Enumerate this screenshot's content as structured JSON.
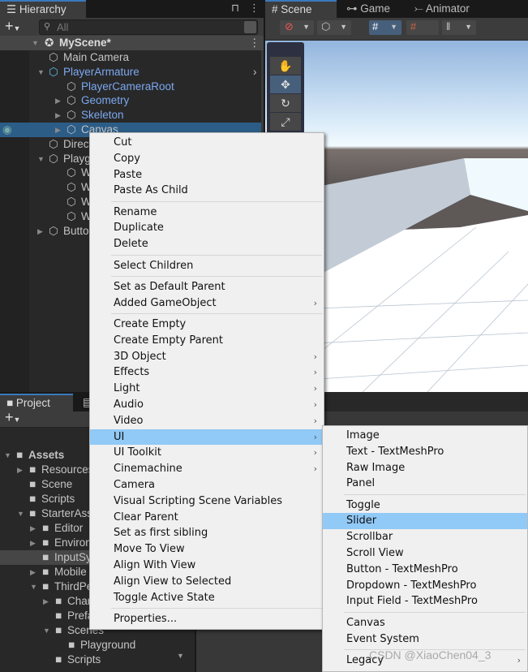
{
  "hierarchy": {
    "tab": "Hierarchy",
    "search_placeholder": "All",
    "scene": "MyScene*",
    "items": [
      {
        "label": "Main Camera",
        "depth": 1,
        "arrow": "",
        "prefab": false
      },
      {
        "label": "PlayerArmature",
        "depth": 1,
        "arrow": "down",
        "prefab": true
      },
      {
        "label": "PlayerCameraRoot",
        "depth": 2,
        "arrow": "",
        "prefab": true
      },
      {
        "label": "Geometry",
        "depth": 2,
        "arrow": "right",
        "prefab": true
      },
      {
        "label": "Skeleton",
        "depth": 2,
        "arrow": "right",
        "prefab": true
      },
      {
        "label": "Canvas",
        "depth": 2,
        "arrow": "right",
        "prefab": false,
        "selected": true
      },
      {
        "label": "Directional Light",
        "depth": 1,
        "arrow": "",
        "prefab": false
      },
      {
        "label": "Playground",
        "depth": 1,
        "arrow": "down",
        "prefab": false
      },
      {
        "label": "Wall",
        "depth": 2,
        "arrow": "",
        "prefab": false
      },
      {
        "label": "Wall",
        "depth": 2,
        "arrow": "",
        "prefab": false
      },
      {
        "label": "Wall",
        "depth": 2,
        "arrow": "",
        "prefab": false
      },
      {
        "label": "Wall",
        "depth": 2,
        "arrow": "",
        "prefab": false
      },
      {
        "label": "Button",
        "depth": 1,
        "arrow": "right",
        "prefab": false
      }
    ]
  },
  "scene_view": {
    "tabs": [
      "Scene",
      "Game",
      "Animator"
    ],
    "active_tab": "Scene"
  },
  "project": {
    "tab": "Project",
    "items": [
      {
        "label": "Assets",
        "depth": 0,
        "arrow": "down",
        "bold": true
      },
      {
        "label": "Resources",
        "depth": 1,
        "arrow": "right"
      },
      {
        "label": "Scene",
        "depth": 1,
        "arrow": ""
      },
      {
        "label": "Scripts",
        "depth": 1,
        "arrow": ""
      },
      {
        "label": "StarterAssets",
        "depth": 1,
        "arrow": "down"
      },
      {
        "label": "Editor",
        "depth": 2,
        "arrow": "right"
      },
      {
        "label": "Environment",
        "depth": 2,
        "arrow": "right"
      },
      {
        "label": "InputSystem",
        "depth": 2,
        "arrow": "",
        "selected": true
      },
      {
        "label": "Mobile",
        "depth": 2,
        "arrow": "right"
      },
      {
        "label": "ThirdPersonController",
        "depth": 2,
        "arrow": "down"
      },
      {
        "label": "Character",
        "depth": 3,
        "arrow": "right"
      },
      {
        "label": "Prefabs",
        "depth": 3,
        "arrow": ""
      },
      {
        "label": "Scenes",
        "depth": 3,
        "arrow": "down"
      },
      {
        "label": "Playground",
        "depth": 4,
        "arrow": ""
      },
      {
        "label": "Scripts",
        "depth": 3,
        "arrow": ""
      }
    ]
  },
  "context_menu": [
    {
      "label": "Cut"
    },
    {
      "label": "Copy"
    },
    {
      "label": "Paste"
    },
    {
      "label": "Paste As Child"
    },
    {
      "sep": true
    },
    {
      "label": "Rename"
    },
    {
      "label": "Duplicate"
    },
    {
      "label": "Delete"
    },
    {
      "sep": true
    },
    {
      "label": "Select Children"
    },
    {
      "sep": true
    },
    {
      "label": "Set as Default Parent"
    },
    {
      "label": "Added GameObject",
      "sub": true
    },
    {
      "sep": true
    },
    {
      "label": "Create Empty"
    },
    {
      "label": "Create Empty Parent"
    },
    {
      "label": "3D Object",
      "sub": true
    },
    {
      "label": "Effects",
      "sub": true
    },
    {
      "label": "Light",
      "sub": true
    },
    {
      "label": "Audio",
      "sub": true
    },
    {
      "label": "Video",
      "sub": true
    },
    {
      "label": "UI",
      "sub": true,
      "highlight": true
    },
    {
      "label": "UI Toolkit",
      "sub": true
    },
    {
      "label": "Cinemachine",
      "sub": true
    },
    {
      "label": "Camera"
    },
    {
      "label": "Visual Scripting Scene Variables"
    },
    {
      "label": "Clear Parent"
    },
    {
      "label": "Set as first sibling"
    },
    {
      "label": "Move To View"
    },
    {
      "label": "Align With View"
    },
    {
      "label": "Align View to Selected"
    },
    {
      "label": "Toggle Active State"
    },
    {
      "sep": true
    },
    {
      "label": "Properties..."
    }
  ],
  "ui_submenu": [
    {
      "label": "Image"
    },
    {
      "label": "Text - TextMeshPro"
    },
    {
      "label": "Raw Image"
    },
    {
      "label": "Panel"
    },
    {
      "sep": true
    },
    {
      "label": "Toggle"
    },
    {
      "label": "Slider",
      "highlight": true
    },
    {
      "label": "Scrollbar"
    },
    {
      "label": "Scroll View"
    },
    {
      "label": "Button - TextMeshPro"
    },
    {
      "label": "Dropdown - TextMeshPro"
    },
    {
      "label": "Input Field - TextMeshPro"
    },
    {
      "sep": true
    },
    {
      "label": "Canvas"
    },
    {
      "label": "Event System"
    },
    {
      "sep": true
    },
    {
      "label": "Legacy",
      "sub": true
    }
  ],
  "watermark": "CSDN @XiaoChen04_3",
  "colors": {
    "selection": "#2c5d87",
    "menu_highlight": "#91c9f7",
    "prefab_text": "#7ba8f0",
    "accent": "#3a79bb"
  }
}
